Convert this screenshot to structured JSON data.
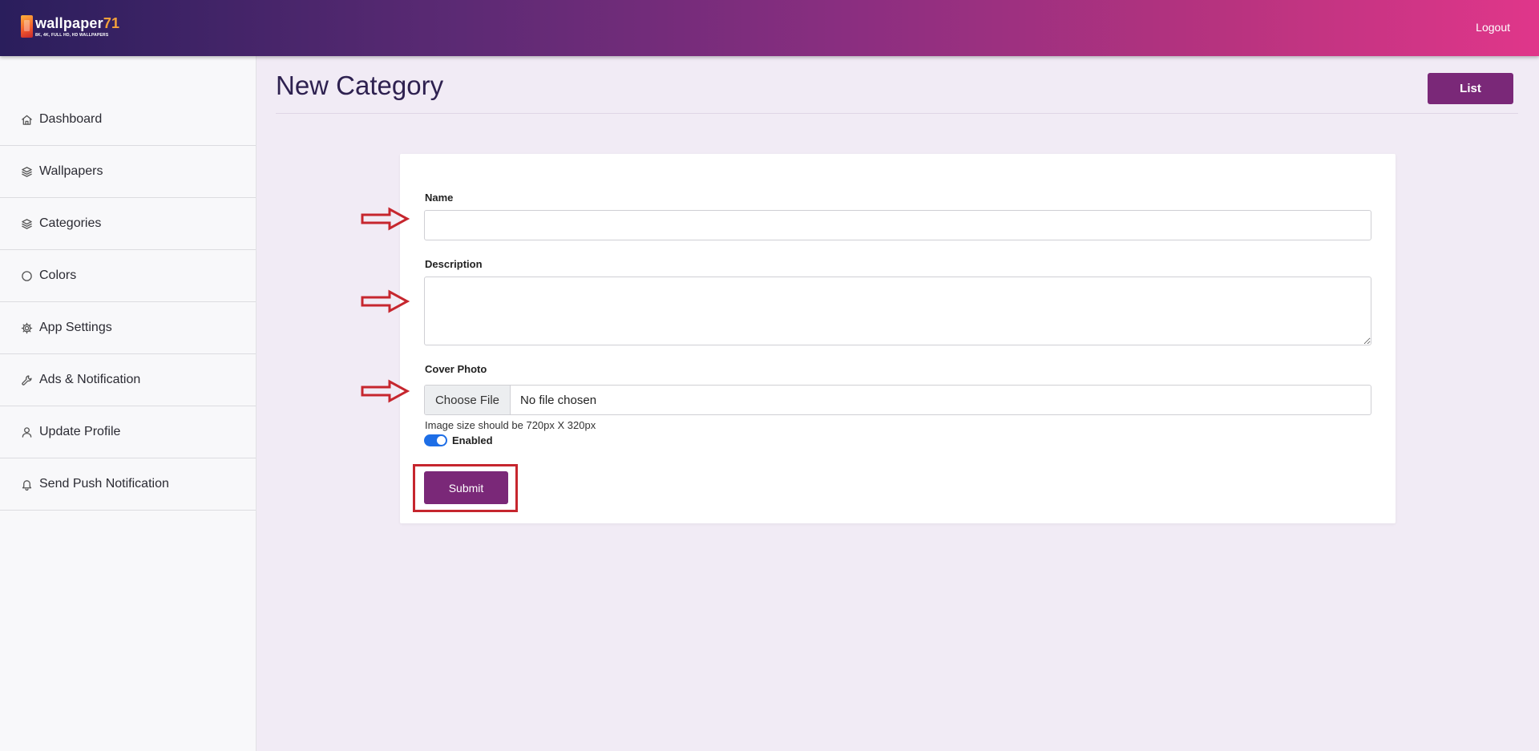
{
  "header": {
    "logo_name": "wallpaper",
    "logo_number": "71",
    "logo_tagline": "8K, 4K, FULL HD, HD WALLPAPERS",
    "logout_label": "Logout"
  },
  "sidebar": {
    "items": [
      {
        "label": "Dashboard",
        "icon": "home-icon"
      },
      {
        "label": "Wallpapers",
        "icon": "layers-icon"
      },
      {
        "label": "Categories",
        "icon": "layers-icon"
      },
      {
        "label": "Colors",
        "icon": "circle-icon"
      },
      {
        "label": "App Settings",
        "icon": "gear-icon"
      },
      {
        "label": "Ads & Notification",
        "icon": "wrench-icon"
      },
      {
        "label": "Update Profile",
        "icon": "user-icon"
      },
      {
        "label": "Send Push Notification",
        "icon": "bell-icon"
      }
    ]
  },
  "page": {
    "title": "New Category",
    "list_button": "List"
  },
  "form": {
    "name_label": "Name",
    "name_value": "",
    "description_label": "Description",
    "description_value": "",
    "cover_label": "Cover Photo",
    "choose_file_label": "Choose File",
    "file_status": "No file chosen",
    "image_hint": "Image size should be 720px X 320px",
    "enabled_label": "Enabled",
    "enabled": true,
    "submit_label": "Submit"
  },
  "colors": {
    "accent": "#7a2878",
    "annotation_red": "#c6262e",
    "toggle_on": "#1e6ee6"
  }
}
